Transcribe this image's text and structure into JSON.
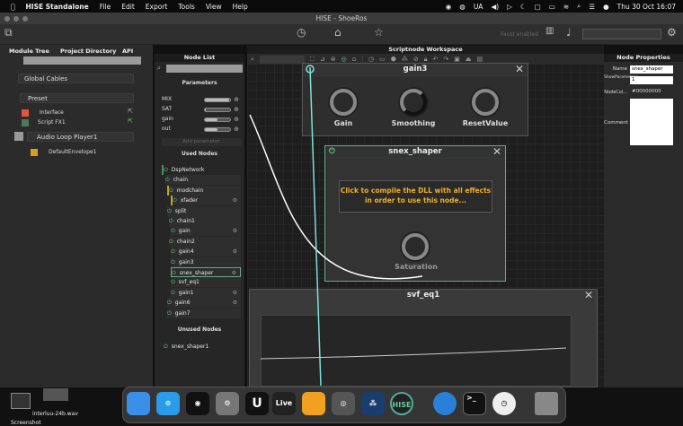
{
  "menubar": {
    "app": "HISE Standalone",
    "items": [
      "File",
      "Edit",
      "Export",
      "Tools",
      "View",
      "Help"
    ],
    "status": [
      "UA"
    ],
    "clock": "Thu 30 Oct  16:07"
  },
  "window": {
    "title": "HISE - ShoeRos"
  },
  "toolbar": {
    "faust": "Faust enabled"
  },
  "left": {
    "tabs": [
      "Module Tree",
      "Project Directory",
      "API"
    ],
    "global_cables": "Global Cables",
    "preset": "Preset",
    "interface": "Interface",
    "script_fx": "Script FX1",
    "audio_loop": "Audio Loop Player1",
    "envelope": "DefaultEnvelope1",
    "colors": {
      "interface": "#e0583a",
      "script_fx": "#4a7a5a",
      "envelope": "#d4a020"
    }
  },
  "nodelist": {
    "title": "Node List",
    "parameters_title": "Parameters",
    "parameters": [
      {
        "name": "MIX",
        "value": 0.95
      },
      {
        "name": "SAT",
        "value": 0.05
      },
      {
        "name": "gain",
        "value": 0.5
      },
      {
        "name": "out",
        "value": 0.5
      }
    ],
    "add_parameter": "Add parameter",
    "used_title": "Used Nodes",
    "used": [
      {
        "name": "DspNetwork",
        "gear": false
      },
      {
        "name": "chain",
        "gear": false
      },
      {
        "name": "modchain",
        "gear": false
      },
      {
        "name": "xfader",
        "gear": true
      },
      {
        "name": "split",
        "gear": false
      },
      {
        "name": "chain1",
        "gear": false
      },
      {
        "name": "gain",
        "gear": true
      },
      {
        "name": "chain2",
        "gear": false
      },
      {
        "name": "gain4",
        "gear": true
      },
      {
        "name": "gain3",
        "gear": false
      },
      {
        "name": "snex_shaper",
        "gear": true,
        "selected": true
      },
      {
        "name": "svf_eq1",
        "gear": false
      },
      {
        "name": "gain1",
        "gear": true
      },
      {
        "name": "gain6",
        "gear": true
      },
      {
        "name": "gain7",
        "gear": false
      }
    ],
    "unused_title": "Unused Nodes",
    "unused": [
      "snex_shaper1"
    ]
  },
  "workspace": {
    "title": "Scriptnode Workspace",
    "gain3": {
      "title": "gain3",
      "knobs": [
        "Gain",
        "Smoothing",
        "ResetValue"
      ]
    },
    "snex": {
      "title": "snex_shaper",
      "message": "Click to compile the DLL with all effects in order to use this node...",
      "knob": "Saturation"
    },
    "svf": {
      "title": "svf_eq1"
    },
    "cable_color": "#7fe0d8"
  },
  "props": {
    "title": "Node Properties",
    "fields": [
      {
        "label": "Name",
        "value": "snex_shaper"
      },
      {
        "label": "ShowParameters",
        "value": "1"
      },
      {
        "label": "NodeCol...",
        "value": "#00000000"
      },
      {
        "label": "Comment",
        "value": ""
      }
    ]
  },
  "desktop": {
    "file": "interluu-24b.wav",
    "screenshot": "Screenshot"
  },
  "dock": {
    "apps": [
      "Finder",
      "Safari",
      "Spotify",
      "System Settings",
      "Unreal",
      "Live",
      "MainStage",
      "Logic",
      "DaVinci",
      "HISE",
      "Network Radar",
      "Terminal",
      "Clock",
      "Trash"
    ],
    "live_label": "Live",
    "hise_label": "HISE"
  }
}
